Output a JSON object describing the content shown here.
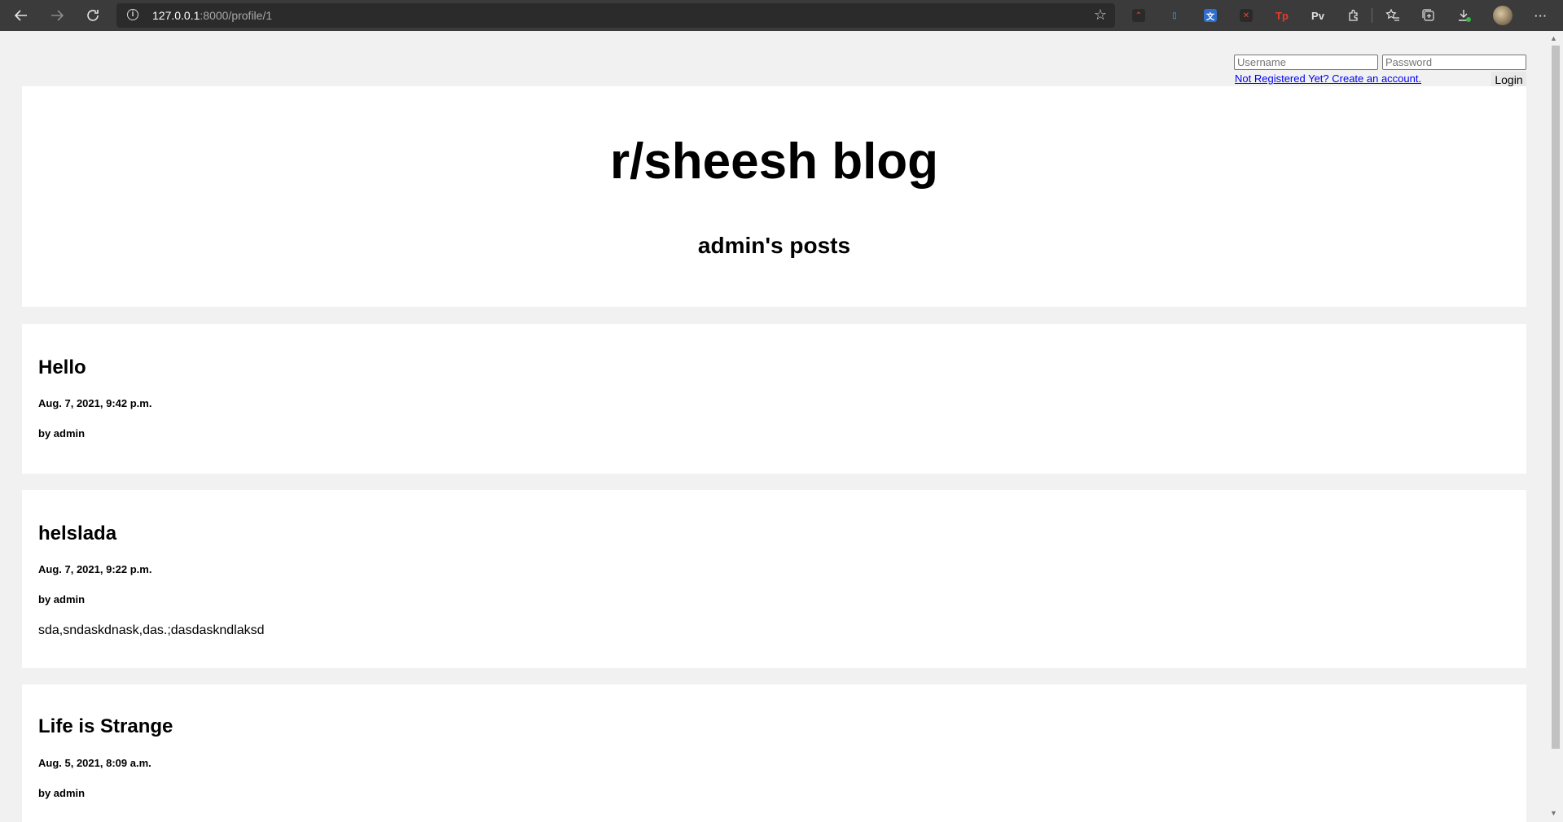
{
  "browser": {
    "url_host": "127.0.0.1",
    "url_path": ":8000/profile/1",
    "extensions": [
      "Tp",
      "Pv"
    ]
  },
  "login": {
    "username_placeholder": "Username",
    "password_placeholder": "Password",
    "signup_link": "Not Registered Yet? Create an account.",
    "login_button": "Login"
  },
  "header": {
    "site_title": "r/sheesh blog",
    "subtitle": "admin's posts"
  },
  "posts": [
    {
      "title": "Hello",
      "date": "Aug. 7, 2021, 9:42 p.m.",
      "author": "by admin",
      "body": ""
    },
    {
      "title": "helslada",
      "date": "Aug. 7, 2021, 9:22 p.m.",
      "author": "by admin",
      "body": "sda,sndaskdnask,das.;dasdaskndlaksd"
    },
    {
      "title": "Life is Strange",
      "date": "Aug. 5, 2021, 8:09 a.m.",
      "author": "by admin",
      "body": ""
    }
  ]
}
